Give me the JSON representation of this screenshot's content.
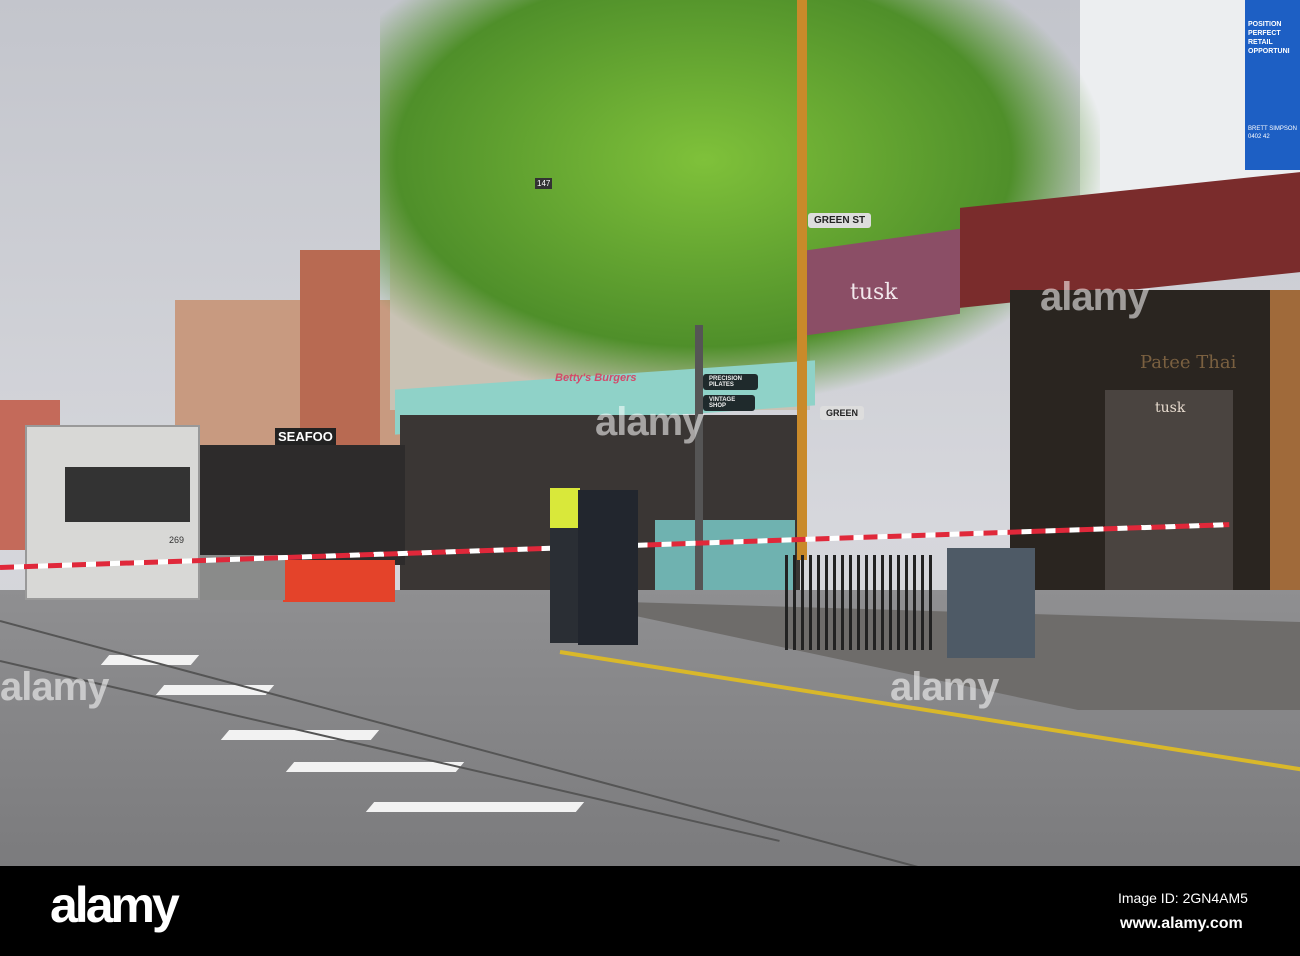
{
  "scene": {
    "street_sign": "GREEN ST",
    "street_sign_2": "GREEN",
    "shop_tusk": "tusk",
    "shop_tusk_window": "tusk",
    "shop_thai": "Patee Thai",
    "shop_seafood": "SEAFOO",
    "shop_burgers": "Betty's Burgers",
    "sign_pilates": "PRECISION PILATES",
    "sign_vintage": "VINTAGE SHOP",
    "building_number": "147",
    "tram_number": "269",
    "billboard_title": "POSITION PERFECT RETAIL OPPORTUNI",
    "billboard_contact": "BRETT SIMPSON 0402 42"
  },
  "watermark": {
    "center": "alamy",
    "left": "alamy",
    "right": "alamy",
    "bottom_left": "alamy"
  },
  "footer": {
    "logo": "alamy",
    "image_id": "Image ID: 2GN4AM5",
    "url": "www.alamy.com"
  }
}
